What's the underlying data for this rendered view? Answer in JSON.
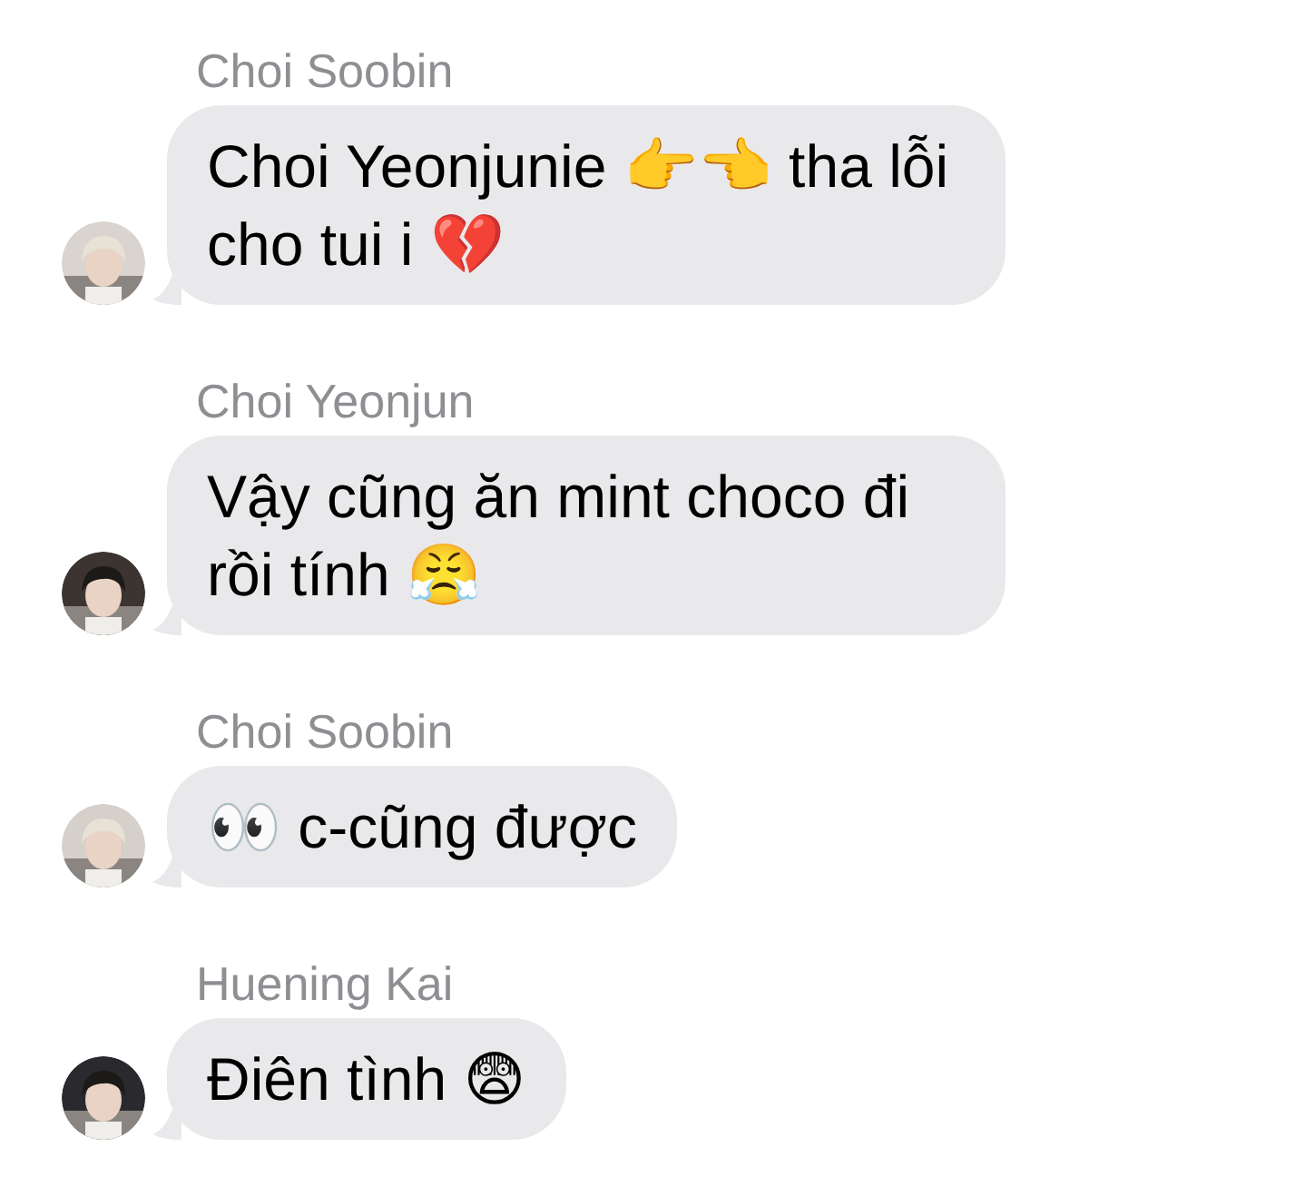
{
  "messages": [
    {
      "sender": "Choi Soobin",
      "text": "Choi Yeonjunie 👉👈 tha lỗi cho tui i 💔"
    },
    {
      "sender": "Choi Yeonjun",
      "text": "Vậy cũng ăn mint choco đi rồi tính 😤"
    },
    {
      "sender": "Choi Soobin",
      "text": "👀 c-cũng được"
    },
    {
      "sender": "Huening Kai",
      "text": "Điên tình 😨"
    }
  ]
}
